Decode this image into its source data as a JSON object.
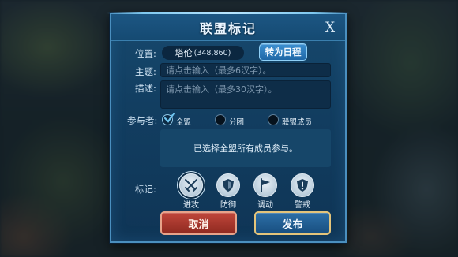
{
  "dialog": {
    "title": "联盟标记",
    "close_label": "X"
  },
  "position": {
    "label": "位置:",
    "name": "塔伦",
    "coords": "(348,860)",
    "schedule_button": "转为日程"
  },
  "topic": {
    "label": "主题:",
    "placeholder": "请点击输入（最多6汉字）。"
  },
  "description": {
    "label": "描述:",
    "placeholder": "请点击输入（最多30汉字）。"
  },
  "participants": {
    "label": "参与者:",
    "options": [
      {
        "label": "全盟",
        "checked": true
      },
      {
        "label": "分团",
        "checked": false
      },
      {
        "label": "联盟成员",
        "checked": false
      }
    ],
    "note": "已选择全盟所有成员参与。"
  },
  "marks": {
    "label": "标记:",
    "items": [
      {
        "label": "进攻",
        "icon": "crossed-swords-icon",
        "selected": true
      },
      {
        "label": "防御",
        "icon": "shield-icon",
        "selected": false
      },
      {
        "label": "调动",
        "icon": "flag-icon",
        "selected": false
      },
      {
        "label": "警戒",
        "icon": "alert-shield-icon",
        "selected": false
      }
    ]
  },
  "buttons": {
    "cancel": "取消",
    "publish": "发布"
  },
  "colors": {
    "panel": "#123e61",
    "border": "#4a8fbf",
    "cancel": "#a8372c",
    "publish": "#1f5d92"
  }
}
